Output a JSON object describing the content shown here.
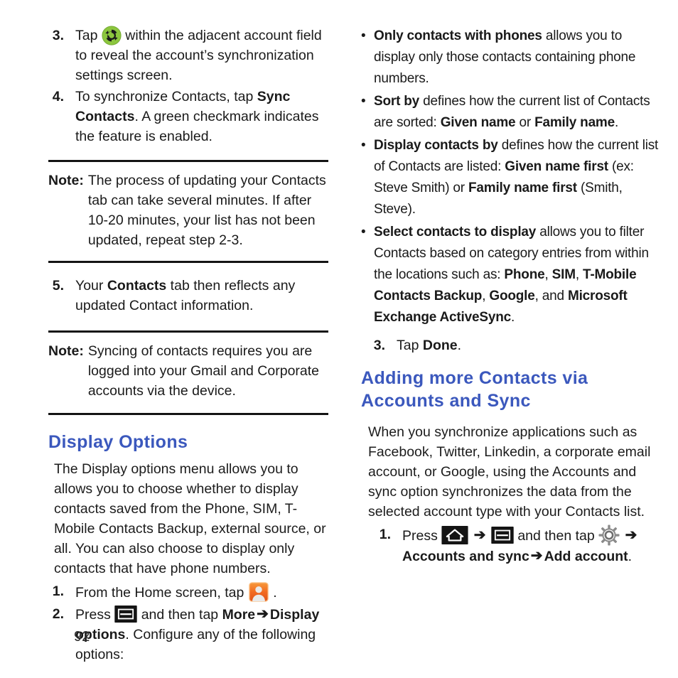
{
  "page_number": "92",
  "colors": {
    "heading_blue": "#3b58bd",
    "body_text": "#1c1c1c",
    "rule": "#141414",
    "sync_icon_green": "#8cc63e",
    "contacts_icon_orange": "#f26a21"
  },
  "left_column": {
    "steps_top": [
      {
        "number": "3.",
        "icon": "sync-icon",
        "parts": [
          {
            "text": "Tap ",
            "bold": false
          },
          {
            "icon": "sync-icon"
          },
          {
            "text": " within the adjacent account field to reveal the account’s synchronization settings screen.",
            "bold": false
          }
        ]
      },
      {
        "number": "4.",
        "parts": [
          {
            "text": "To synchronize Contacts, tap ",
            "bold": false
          },
          {
            "text": "Sync Contacts",
            "bold": true
          },
          {
            "text": ". A green checkmark indicates the feature is enabled.",
            "bold": false
          }
        ]
      }
    ],
    "note_1": {
      "label": "Note:",
      "text": "The process of updating your Contacts tab can take several minutes. If after 10-20 minutes, your list has not been updated, repeat step 2-3."
    },
    "step_5": {
      "number": "5.",
      "parts": [
        {
          "text": "Your ",
          "bold": false
        },
        {
          "text": "Contacts",
          "bold": true
        },
        {
          "text": " tab then reflects any updated Contact information.",
          "bold": false
        }
      ]
    },
    "note_2": {
      "label": "Note:",
      "text": "Syncing of contacts requires you are logged into your Gmail and Corporate accounts via the device."
    },
    "heading": "Display Options",
    "intro": "The Display options menu allows you to allows you to choose whether to display contacts saved from the Phone, SIM, T-Mobile Contacts Backup, external source, or all. You can also choose to display only contacts that have phone numbers.",
    "steps_bottom": [
      {
        "number": "1.",
        "parts": [
          {
            "text": "From the Home screen, tap ",
            "bold": false
          },
          {
            "icon": "contacts-icon"
          },
          {
            "text": " .",
            "bold": false
          }
        ]
      },
      {
        "number": "2.",
        "parts": [
          {
            "text": "Press ",
            "bold": false
          },
          {
            "icon": "menu-icon"
          },
          {
            "text": " and then tap ",
            "bold": false
          },
          {
            "text": "More",
            "bold": true
          },
          {
            "arrow": "➔"
          },
          {
            "text": "Display options",
            "bold": true
          },
          {
            "text": ". Configure any of the following options:",
            "bold": false
          }
        ]
      }
    ]
  },
  "right_column": {
    "bullets": [
      {
        "parts": [
          {
            "text": "Only contacts with phones",
            "bold": true
          },
          {
            "text": " allows you to display only those contacts containing phone numbers.",
            "bold": false
          }
        ]
      },
      {
        "parts": [
          {
            "text": "Sort by",
            "bold": true
          },
          {
            "text": " defines how the current list of Contacts are sorted: ",
            "bold": false
          },
          {
            "text": "Given name",
            "bold": true
          },
          {
            "text": " or ",
            "bold": false
          },
          {
            "text": "Family name",
            "bold": true
          },
          {
            "text": ".",
            "bold": false
          }
        ]
      },
      {
        "parts": [
          {
            "text": "Display contacts by",
            "bold": true
          },
          {
            "text": " defines how the current list of Contacts are listed: ",
            "bold": false
          },
          {
            "text": "Given name first",
            "bold": true
          },
          {
            "text": " (ex: Steve Smith) or ",
            "bold": false
          },
          {
            "text": "Family name first",
            "bold": true
          },
          {
            "text": " (Smith, Steve).",
            "bold": false
          }
        ]
      },
      {
        "parts": [
          {
            "text": "Select contacts to display",
            "bold": true
          },
          {
            "text": " allows you to filter Contacts based on category entries from within the locations such as: ",
            "bold": false
          },
          {
            "text": "Phone",
            "bold": true
          },
          {
            "text": ", ",
            "bold": false
          },
          {
            "text": "SIM",
            "bold": true
          },
          {
            "text": ", ",
            "bold": false
          },
          {
            "text": "T-Mobile Contacts Backup",
            "bold": true
          },
          {
            "text": ", ",
            "bold": false
          },
          {
            "text": "Google",
            "bold": true
          },
          {
            "text": ", and ",
            "bold": false
          },
          {
            "text": "Microsoft Exchange ActiveSync",
            "bold": true
          },
          {
            "text": ".",
            "bold": false
          }
        ]
      }
    ],
    "step_3": {
      "number": "3.",
      "parts": [
        {
          "text": "Tap ",
          "bold": false
        },
        {
          "text": "Done",
          "bold": true
        },
        {
          "text": ".",
          "bold": false
        }
      ]
    },
    "heading_line_1": "Adding more Contacts via",
    "heading_line_2": "Accounts and Sync",
    "intro": "When you synchronize applications such as Facebook, Twitter, Linkedin, a corporate email account, or Google, using the Accounts and sync option synchronizes the data from the selected account type with your Contacts list.",
    "step_1": {
      "number": "1.",
      "parts": [
        {
          "text": "Press ",
          "bold": false
        },
        {
          "icon": "home-icon"
        },
        {
          "arrow": "➔"
        },
        {
          "icon": "menu-icon"
        },
        {
          "text": " and then tap ",
          "bold": false
        },
        {
          "icon": "gear-icon"
        },
        {
          "arrow": "➔"
        },
        {
          "text": "Accounts and sync",
          "bold": true
        },
        {
          "arrow": "➔"
        },
        {
          "text": "Add account",
          "bold": true
        },
        {
          "text": ".",
          "bold": false
        }
      ]
    }
  }
}
